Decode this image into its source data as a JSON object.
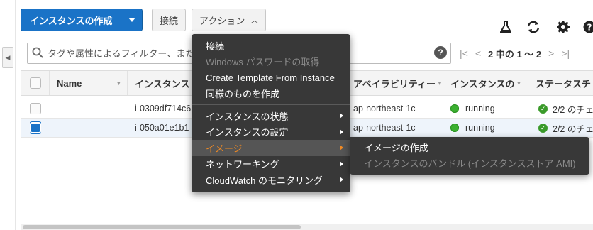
{
  "toolbar": {
    "launch_label": "インスタンスの作成",
    "connect_label": "接続",
    "actions_label": "アクション"
  },
  "icons": {
    "flask": "flask-icon",
    "refresh": "refresh-icon",
    "settings": "gear-icon",
    "help": "help-icon"
  },
  "filter": {
    "placeholder": "タグや属性によるフィルター、また"
  },
  "pager": {
    "text": "2 中の 1 ～ 2"
  },
  "table": {
    "columns": [
      "Name",
      "インスタンス",
      "アベイラビリティー",
      "インスタンスの",
      "ステータスチ"
    ],
    "rows": [
      {
        "selected": false,
        "name": "",
        "instance_id": "i-0309df714c6",
        "az": "ap-northeast-1c",
        "state": "running",
        "status": "2/2 のチェ"
      },
      {
        "selected": true,
        "name": "",
        "instance_id": "i-050a01e1b1",
        "az": "ap-northeast-1c",
        "state": "running",
        "status": "2/2 のチェ"
      }
    ]
  },
  "menu": {
    "items": [
      {
        "label": "接続",
        "disabled": false
      },
      {
        "label": "Windows パスワードの取得",
        "disabled": true
      },
      {
        "label": "Create Template From Instance",
        "disabled": false
      },
      {
        "label": "同様のものを作成",
        "disabled": false
      },
      {
        "label": "インスタンスの状態",
        "submenu": true
      },
      {
        "label": "インスタンスの設定",
        "submenu": true
      },
      {
        "label": "イメージ",
        "submenu": true,
        "active": true
      },
      {
        "label": "ネットワーキング",
        "submenu": true
      },
      {
        "label": "CloudWatch のモニタリング",
        "submenu": true
      }
    ]
  },
  "submenu": {
    "items": [
      {
        "label": "イメージの作成",
        "disabled": false
      },
      {
        "label": "インスタンスのバンドル (インスタンスストア AMI)",
        "disabled": true
      }
    ]
  },
  "colors": {
    "primary": "#1a73c7",
    "menu_bg": "#383838",
    "active_text": "#f08a24",
    "running": "#3bb030"
  }
}
